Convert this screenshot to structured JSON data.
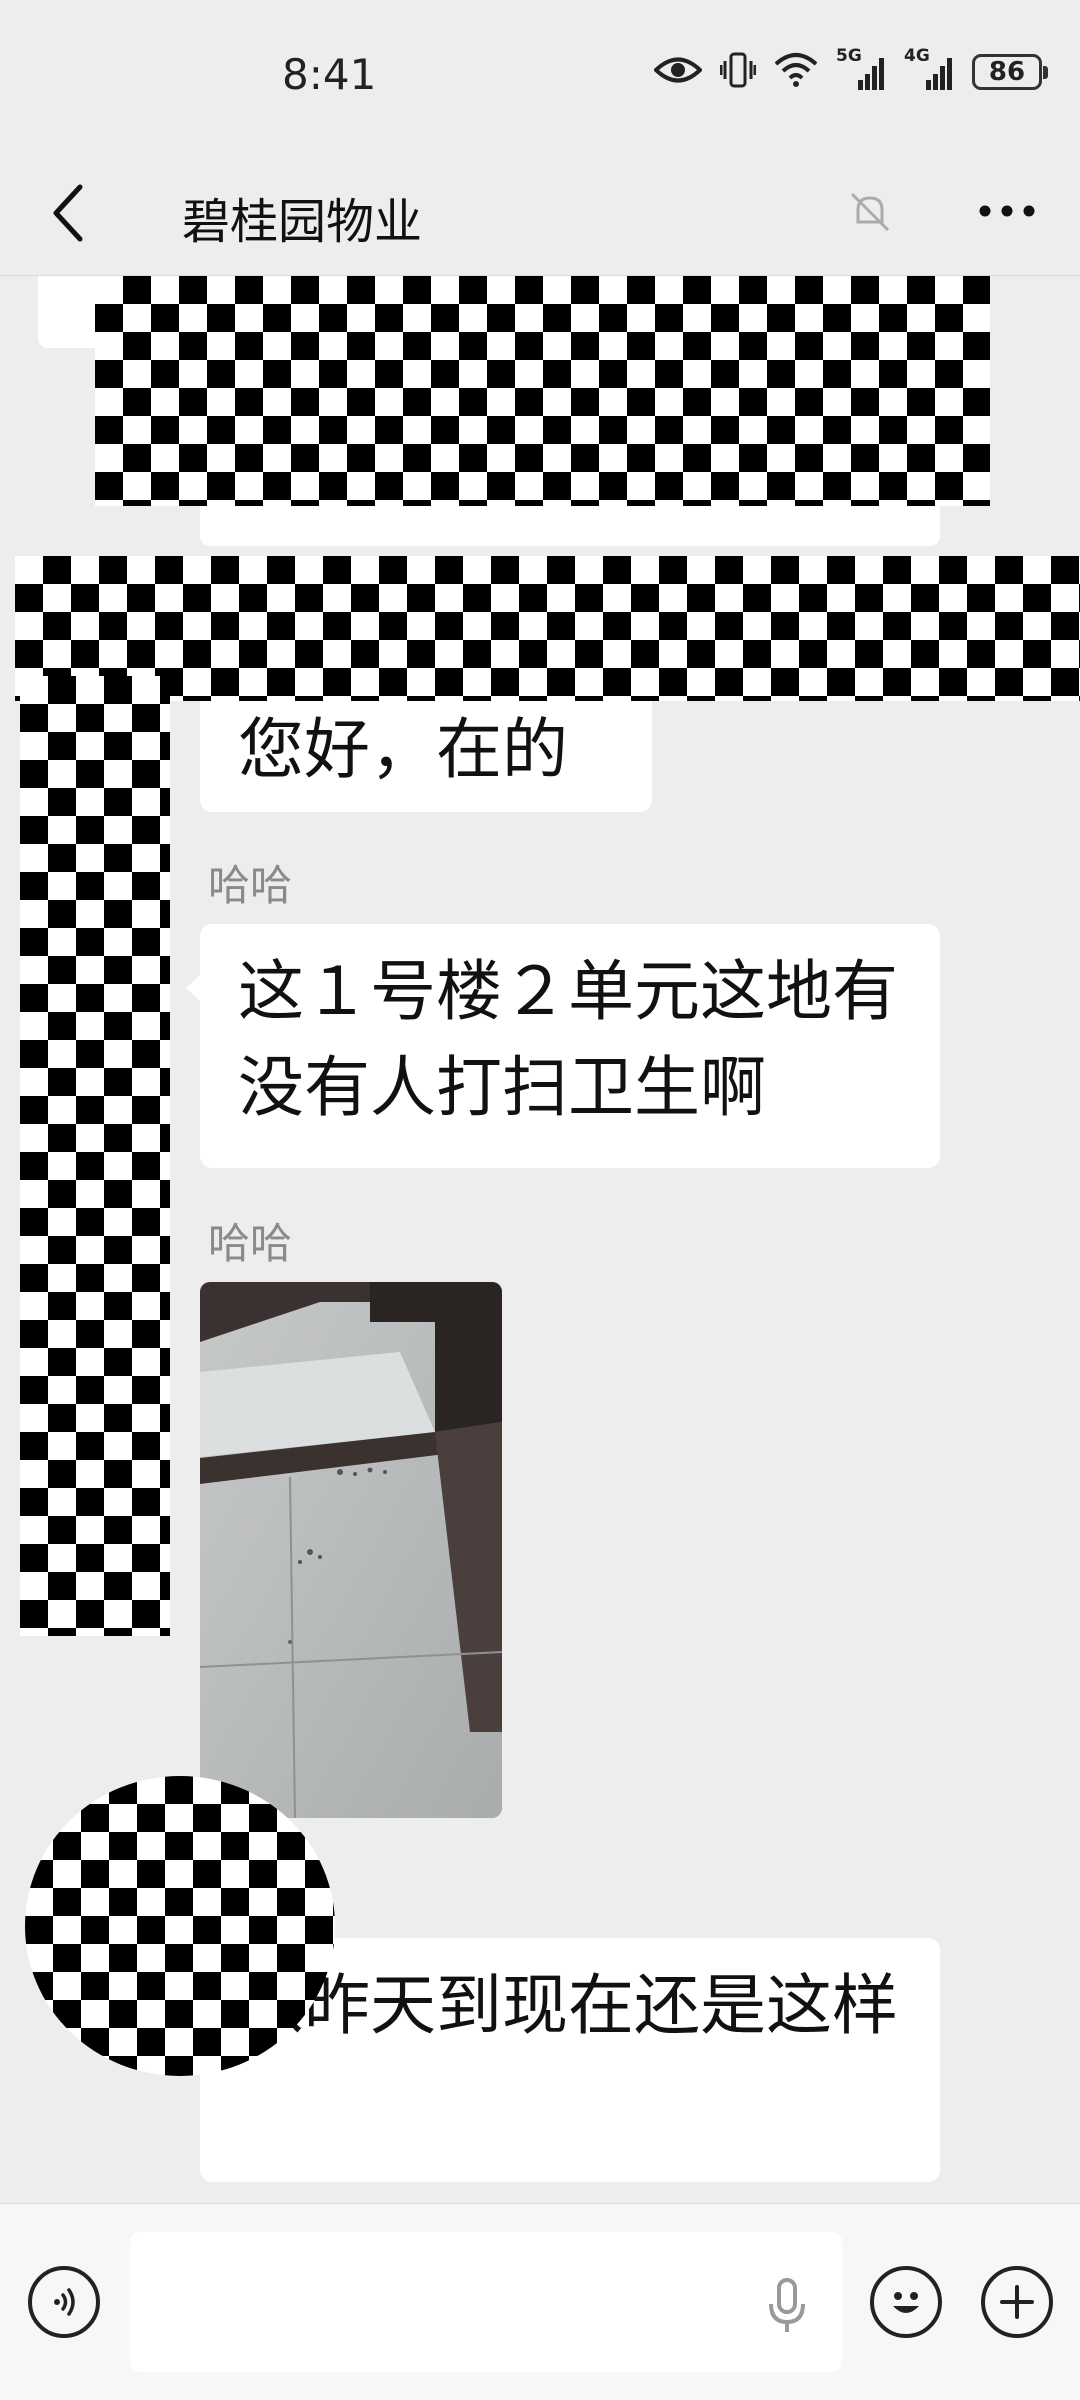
{
  "status_bar": {
    "time": "8:41",
    "signal1_label": "5G",
    "signal2_label": "4G",
    "battery": "86"
  },
  "header": {
    "title": "碧桂园物业"
  },
  "messages": [
    {
      "type": "text",
      "sender": "",
      "text": "您好，在的"
    },
    {
      "type": "text",
      "sender": "哈哈",
      "text": "这１号楼２单元这地有没有人打扫卫生啊"
    },
    {
      "type": "image",
      "sender": "哈哈"
    },
    {
      "type": "text",
      "sender": "",
      "text": "从昨天到现在还是这样"
    }
  ],
  "input_bar": {
    "placeholder": ""
  },
  "colors": {
    "background": "#ededed",
    "bubble": "#ffffff",
    "sender_name": "#8a8a8a"
  }
}
